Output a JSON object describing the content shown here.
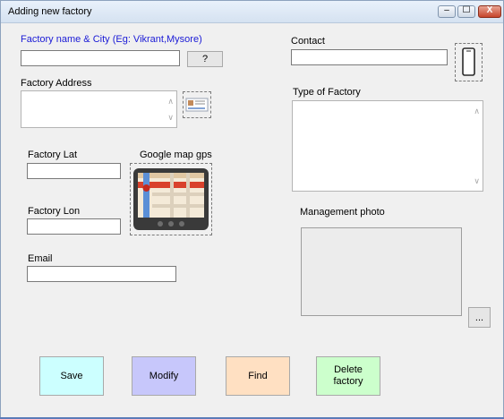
{
  "window": {
    "title": "Adding new factory",
    "controls": {
      "minimize": "‒",
      "maximize": "☐",
      "close": "X"
    }
  },
  "form": {
    "factory_name_label": "Factory name & City (Eg: Vikrant,Mysore)",
    "factory_name_value": "",
    "help_button": "?",
    "contact_label": "Contact",
    "contact_value": "",
    "address_label": "Factory Address",
    "address_value": "",
    "type_label": "Type of Factory",
    "type_value": "",
    "lat_label": "Factory Lat",
    "lat_value": "",
    "gps_label": "Google map gps",
    "lon_label": "Factory Lon",
    "lon_value": "",
    "mgmt_photo_label": "Management photo",
    "browse_button": "...",
    "email_label": "Email",
    "email_value": ""
  },
  "buttons": {
    "save": "Save",
    "modify": "Modify",
    "find": "Find",
    "delete": "Delete factory"
  },
  "colors": {
    "save": "#ccffff",
    "modify": "#c7c7fb",
    "find": "#ffe0c2",
    "delete": "#ccffcc",
    "label_blue": "#1a1ad6"
  },
  "icons": {
    "phone": "phone-icon",
    "address_card": "address-card-icon",
    "map": "map-gps-icon"
  }
}
